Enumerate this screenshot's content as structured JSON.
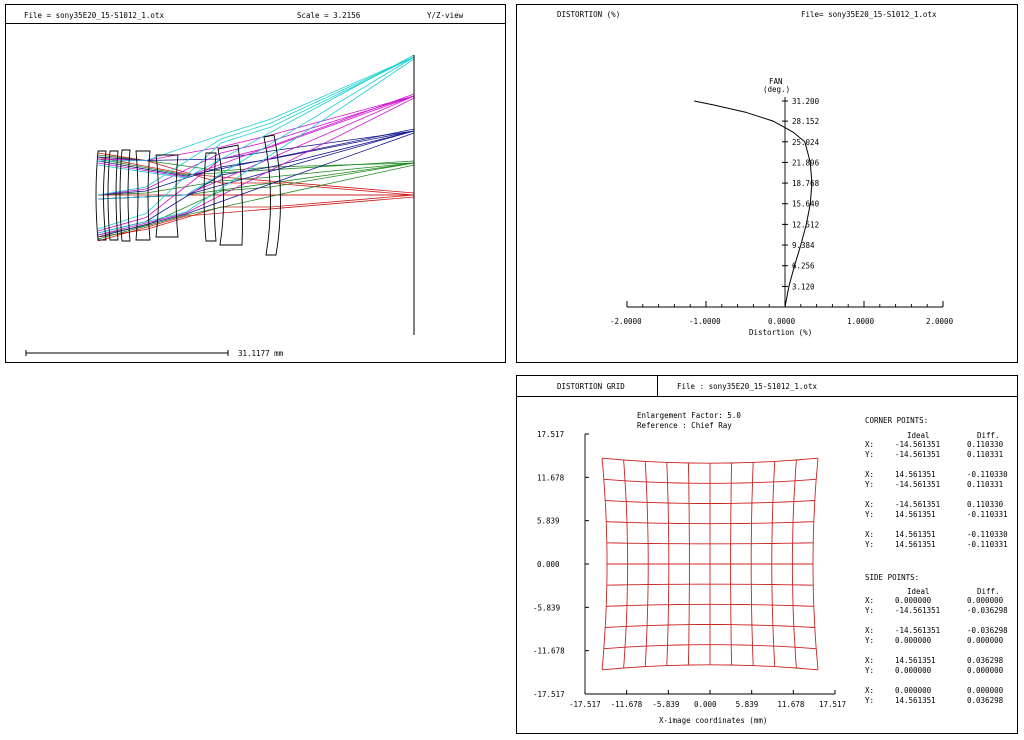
{
  "layout_panel": {
    "file_label": "File = sony35E20_15-S1012_1.otx",
    "scale_label": "Scale = 3.2156",
    "view_label": "Y/Z-view",
    "scale_bar_label": "31.1177 mm"
  },
  "distortion_panel": {
    "title": "DISTORTION (%)",
    "file_label": "File=   sony35E20_15-S1012_1.otx",
    "yaxis_title_line1": "FAN",
    "yaxis_title_line2": "(deg.)",
    "xlabel": "Distortion (%)",
    "chart_data": {
      "type": "line",
      "x_unit": "Distortion (%)",
      "y_unit": "FAN (deg.)",
      "xlim": [
        -2.0,
        2.0
      ],
      "ylim": [
        0,
        31.2
      ],
      "x_ticks": [
        "-2.0000",
        "-1.0000",
        "0.0000",
        "1.0000",
        "2.0000"
      ],
      "x_tick_values": [
        -2.0,
        -1.0,
        0.0,
        1.0,
        2.0
      ],
      "y_ticks": [
        "3.120",
        "6.256",
        "9.384",
        "12.512",
        "15.640",
        "18.768",
        "21.896",
        "25.024",
        "28.152",
        "31.200"
      ],
      "y_tick_values": [
        3.12,
        6.256,
        9.384,
        12.512,
        15.64,
        18.768,
        21.896,
        25.024,
        28.152,
        31.2
      ],
      "series": [
        {
          "x": [
            0.0,
            0.05,
            0.12,
            0.2,
            0.27,
            0.32,
            0.34,
            0.32,
            0.25,
            0.1,
            -0.15,
            -0.5,
            -0.9,
            -1.15
          ],
          "y": [
            0,
            3.12,
            6.256,
            9.384,
            12.512,
            15.64,
            18.768,
            21.896,
            25.024,
            26.5,
            28.152,
            29.5,
            30.6,
            31.2
          ]
        }
      ]
    }
  },
  "grid_panel": {
    "title": "DISTORTION GRID",
    "file_label": "File : sony35E20_15-S1012_1.otx",
    "enlargement": "Enlargement Factor: 5.0",
    "reference": "Reference : Chief Ray",
    "xlabel": "X-image coordinates (mm)",
    "y_ticks": [
      "17.517",
      "11.678",
      "5.839",
      "0.000",
      "-5.839",
      "-11.678",
      "-17.517"
    ],
    "x_ticks": [
      "-17.517",
      "-11.678",
      "-5.839",
      "0.000",
      "5.839",
      "11.678",
      "17.517"
    ],
    "corner_title": "CORNER POINTS:",
    "side_title": "SIDE POINTS:",
    "col_ideal": "Ideal",
    "col_diff": "Diff.",
    "corner_points": [
      {
        "xl": "X:",
        "xi": "-14.561351",
        "xd": "0.110330",
        "yl": "Y:",
        "yi": "-14.561351",
        "yd": "0.110331"
      },
      {
        "xl": "X:",
        "xi": "14.561351",
        "xd": "-0.110330",
        "yl": "Y:",
        "yi": "-14.561351",
        "yd": "0.110331"
      },
      {
        "xl": "X:",
        "xi": "-14.561351",
        "xd": "0.110330",
        "yl": "Y:",
        "yi": "14.561351",
        "yd": "-0.110331"
      },
      {
        "xl": "X:",
        "xi": "14.561351",
        "xd": "-0.110330",
        "yl": "Y:",
        "yi": "14.561351",
        "yd": "-0.110331"
      }
    ],
    "side_points": [
      {
        "xl": "X:",
        "xi": "0.000000",
        "xd": "0.000000",
        "yl": "Y:",
        "yi": "-14.561351",
        "yd": "-0.036298"
      },
      {
        "xl": "X:",
        "xi": "-14.561351",
        "xd": "-0.036298",
        "yl": "Y:",
        "yi": "0.000000",
        "yd": "0.000000"
      },
      {
        "xl": "X:",
        "xi": "14.561351",
        "xd": "0.036298",
        "yl": "Y:",
        "yi": "0.000000",
        "yd": "0.000000"
      },
      {
        "xl": "X:",
        "xi": "0.000000",
        "xd": "0.000000",
        "yl": "Y:",
        "yi": "14.561351",
        "yd": "0.036298"
      }
    ],
    "grid_color": "#cc2222"
  },
  "ray_colors": [
    "#d01818",
    "#1e8a1e",
    "#14148e",
    "#d010d0",
    "#18d0d0"
  ]
}
